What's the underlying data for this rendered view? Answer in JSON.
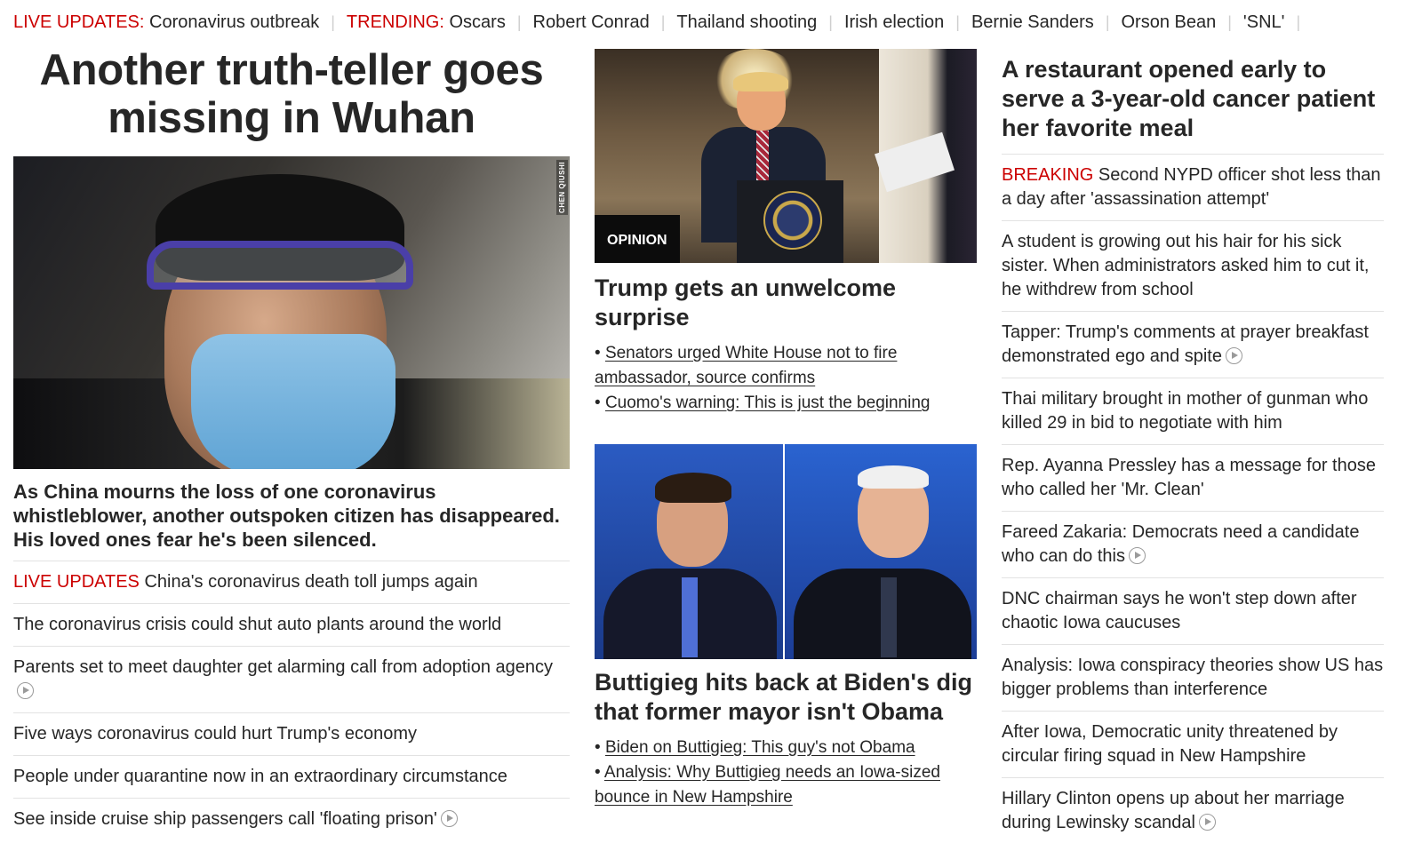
{
  "topbar": {
    "live_label": "LIVE UPDATES:",
    "live_link": "Coronavirus outbreak",
    "trending_label": "TRENDING:",
    "trending": [
      "Oscars",
      "Robert Conrad",
      "Thailand shooting",
      "Irish election",
      "Bernie Sanders",
      "Orson Bean",
      "'SNL'"
    ]
  },
  "col1": {
    "headline": "Another truth-teller goes missing in Wuhan",
    "image_credit": "CHEN QIUSHI",
    "description": "As China mourns the loss of one coronavirus whistleblower, another outspoken citizen has disappeared. His loved ones fear he's been silenced.",
    "items": [
      {
        "tag": "LIVE UPDATES",
        "text": " China's coronavirus death toll jumps again",
        "video": false
      },
      {
        "tag": "",
        "text": "The coronavirus crisis could shut auto plants around the world",
        "video": false
      },
      {
        "tag": "",
        "text": "Parents set to meet daughter get alarming call from adoption agency",
        "video": true
      },
      {
        "tag": "",
        "text": "Five ways coronavirus could hurt Trump's economy",
        "video": false
      },
      {
        "tag": "",
        "text": "People under quarantine now in an extraordinary circumstance",
        "video": false
      },
      {
        "tag": "",
        "text": "See inside cruise ship passengers call 'floating prison'",
        "video": true
      }
    ]
  },
  "col2": {
    "story1": {
      "badge": "OPINION",
      "headline": "Trump gets an unwelcome surprise",
      "bullets": [
        "Senators urged White House not to fire ambassador, source confirms",
        "Cuomo's warning: This is just the beginning"
      ]
    },
    "story2": {
      "headline": "Buttigieg hits back at Biden's dig that former mayor isn't Obama",
      "bullets": [
        "Biden on Buttigieg: This guy's not Obama",
        "Analysis: Why Buttigieg needs an Iowa-sized bounce in New Hampshire"
      ]
    }
  },
  "col3": {
    "lead": "A restaurant opened early to serve a 3-year-old cancer patient her favorite meal",
    "items": [
      {
        "tag": "BREAKING",
        "text": " Second NYPD officer shot less than a day after 'assassination attempt'",
        "video": false
      },
      {
        "tag": "",
        "text": "A student is growing out his hair for his sick sister. When administrators asked him to cut it, he withdrew from school",
        "video": false
      },
      {
        "tag": "",
        "text": "Tapper: Trump's comments at prayer breakfast demonstrated ego and spite",
        "video": true
      },
      {
        "tag": "",
        "text": "Thai military brought in mother of gunman who killed 29 in bid to negotiate with him",
        "video": false
      },
      {
        "tag": "",
        "text": "Rep. Ayanna Pressley has a message for those who called her 'Mr. Clean'",
        "video": false
      },
      {
        "tag": "",
        "text": "Fareed Zakaria: Democrats need a candidate who can do this",
        "video": true
      },
      {
        "tag": "",
        "text": "DNC chairman says he won't step down after chaotic Iowa caucuses",
        "video": false
      },
      {
        "tag": "",
        "text": "Analysis: Iowa conspiracy theories show US has bigger problems than interference",
        "video": false
      },
      {
        "tag": "",
        "text": "After Iowa, Democratic unity threatened by circular firing squad in New Hampshire",
        "video": false
      },
      {
        "tag": "",
        "text": "Hillary Clinton opens up about her marriage during Lewinsky scandal",
        "video": true
      }
    ]
  },
  "colors": {
    "accent_red": "#cc0000",
    "text": "#262626",
    "divider": "#e2e2e2"
  }
}
